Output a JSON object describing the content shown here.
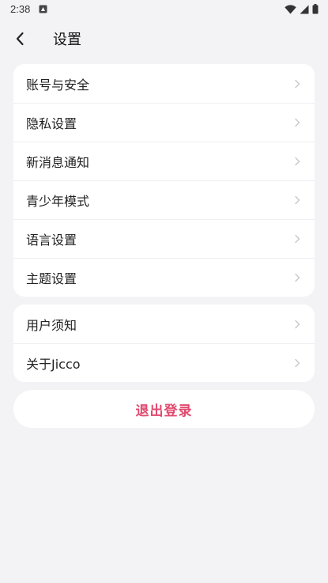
{
  "status_bar": {
    "time": "2:38",
    "notification_icon": "android-notification-icon",
    "icons": [
      "wifi-icon",
      "cell-signal-icon",
      "battery-icon"
    ]
  },
  "header": {
    "title": "设置",
    "back_icon": "chevron-left-icon"
  },
  "group1": {
    "items": [
      {
        "label": "账号与安全"
      },
      {
        "label": "隐私设置"
      },
      {
        "label": "新消息通知"
      },
      {
        "label": "青少年模式"
      },
      {
        "label": "语言设置"
      },
      {
        "label": "主题设置"
      }
    ]
  },
  "group2": {
    "items": [
      {
        "label": "用户须知"
      },
      {
        "label": "关于Jicco"
      }
    ]
  },
  "logout": {
    "label": "退出登录"
  },
  "colors": {
    "background": "#f3f3f5",
    "card": "#ffffff",
    "logout_text": "#e04a6f",
    "chevron": "#c7c7cc"
  }
}
